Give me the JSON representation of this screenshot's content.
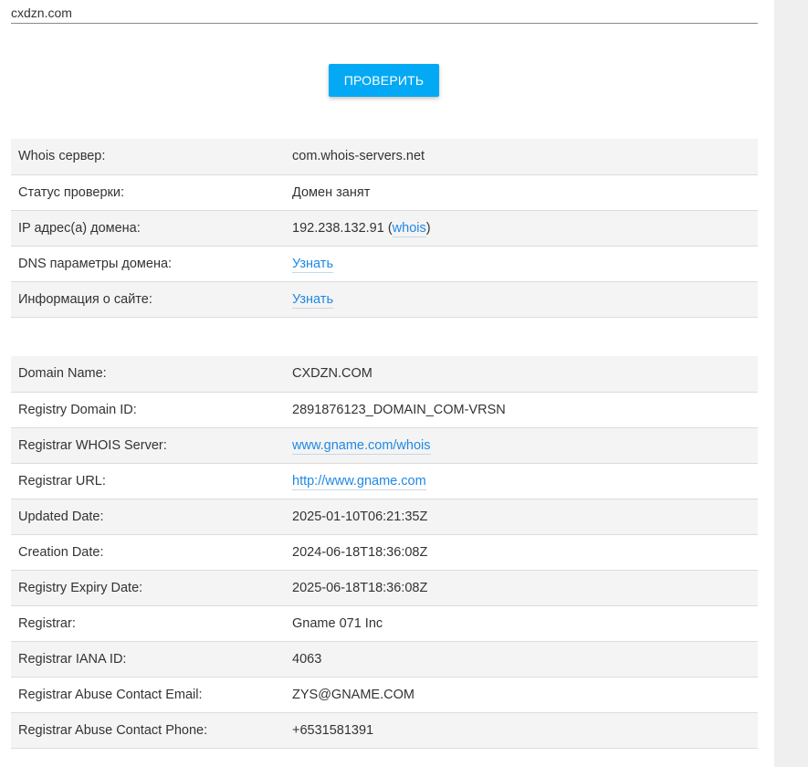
{
  "search": {
    "value": "cxdzn.com"
  },
  "check_button": {
    "label": "ПРОВЕРИТЬ"
  },
  "check_info": {
    "whois_server": {
      "label": "Whois сервер:",
      "value": "com.whois-servers.net"
    },
    "status": {
      "label": "Статус проверки:",
      "value": "Домен занят"
    },
    "ip": {
      "label": "IP адрес(а) домена:",
      "value": "192.238.132.91",
      "open": " (",
      "link": "whois",
      "close": ")"
    },
    "dns": {
      "label": "DNS параметры домена:",
      "link": "Узнать"
    },
    "site_info": {
      "label": "Информация о сайте:",
      "link": "Узнать"
    }
  },
  "whois": {
    "domain_name": {
      "label": "Domain Name:",
      "value": "CXDZN.COM"
    },
    "registry_domain_id": {
      "label": "Registry Domain ID:",
      "value": "2891876123_DOMAIN_COM-VRSN"
    },
    "registrar_whois_server": {
      "label": "Registrar WHOIS Server:",
      "link": "www.gname.com/whois"
    },
    "registrar_url": {
      "label": "Registrar URL:",
      "link": "http://www.gname.com"
    },
    "updated_date": {
      "label": "Updated Date:",
      "value": "2025-01-10T06:21:35Z"
    },
    "creation_date": {
      "label": "Creation Date:",
      "value": "2024-06-18T18:36:08Z"
    },
    "expiry_date": {
      "label": "Registry Expiry Date:",
      "value": "2025-06-18T18:36:08Z"
    },
    "registrar": {
      "label": "Registrar:",
      "value": "Gname 071 Inc"
    },
    "iana_id": {
      "label": "Registrar IANA ID:",
      "value": "4063"
    },
    "abuse_email": {
      "label": "Registrar Abuse Contact Email:",
      "value": "ZYS@GNAME.COM"
    },
    "abuse_phone": {
      "label": "Registrar Abuse Contact Phone:",
      "value": "+6531581391"
    }
  },
  "colors": {
    "accent": "#03a9f4",
    "link": "#1e88e5",
    "row_alt": "#f4f4f4",
    "gutter": "#efefef"
  }
}
